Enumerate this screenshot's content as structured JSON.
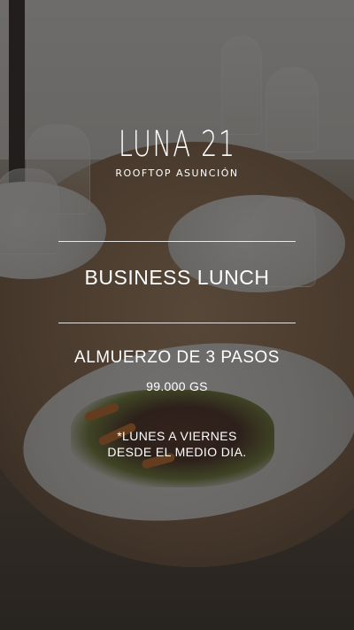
{
  "logo": {
    "name": "LUNA 21",
    "tagline": "ROOFTOP ASUNCIÓN"
  },
  "promo": {
    "title": "BUSINESS LUNCH",
    "subtitle": "ALMUERZO DE 3 PASOS",
    "price": "99.000 GS",
    "note_line1": "*LUNES A VIERNES",
    "note_line2": "DESDE EL MEDIO DIA."
  }
}
